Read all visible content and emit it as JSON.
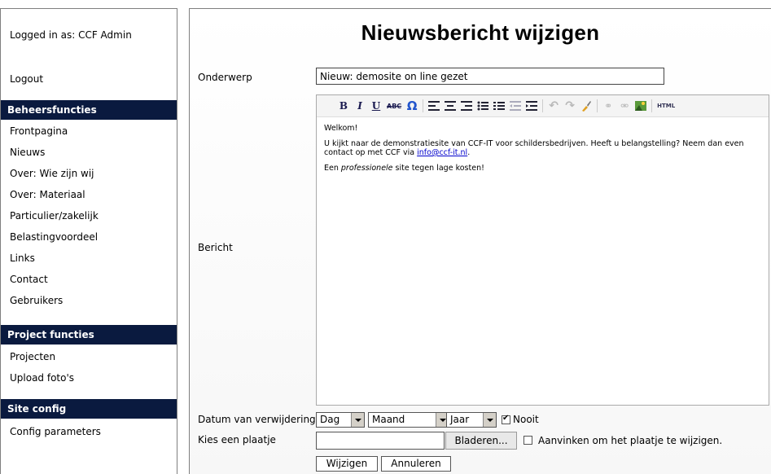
{
  "sidebar": {
    "logged_in": "Logged in as: CCF Admin",
    "logout": "Logout",
    "sections": [
      {
        "title": "Beheersfuncties",
        "items": [
          "Frontpagina",
          "Nieuws",
          "Over: Wie zijn wij",
          "Over: Materiaal",
          "Particulier/zakelijk",
          "Belastingvoordeel",
          "Links",
          "Contact",
          "Gebruikers"
        ]
      },
      {
        "title": "Project functies",
        "items": [
          "Projecten",
          "Upload foto's"
        ]
      },
      {
        "title": "Site config",
        "items": [
          "Config parameters"
        ]
      }
    ]
  },
  "main": {
    "title": "Nieuwsbericht wijzigen",
    "labels": {
      "subject": "Onderwerp",
      "message": "Bericht",
      "removal_date": "Datum van verwijdering",
      "image": "Kies een plaatje"
    },
    "subject_value": "Nieuw: demosite on line gezet",
    "editor": {
      "toolbar": {
        "bold": "B",
        "italic": "I",
        "underline": "U",
        "strike": "ABC",
        "omega": "Ω",
        "html": "HTML"
      },
      "p1": "Welkom!",
      "p2": "U kijkt naar de demonstratiesite van CCF-IT voor schildersbedrijven. Heeft u belangstelling? Neem dan even contact op met CCF via ",
      "p2_link": "info@ccf-it.nl",
      "p2_end": ".",
      "p3_pre": "Een ",
      "p3_em": "professionele",
      "p3_post": " site tegen lage kosten!"
    },
    "date": {
      "day": "Dag",
      "month": "Maand",
      "year": "Jaar",
      "never_label": "Nooit",
      "never_checked": true
    },
    "image": {
      "browse": "Bladeren...",
      "change_label": "Aanvinken om het plaatje te wijzigen.",
      "change_checked": false
    },
    "buttons": {
      "submit": "Wijzigen",
      "cancel": "Annuleren"
    }
  },
  "colors": {
    "sidebar_header_bg": "#0a1a3f",
    "sidebar_header_text": "#ffffff",
    "link": "#0000cc"
  }
}
